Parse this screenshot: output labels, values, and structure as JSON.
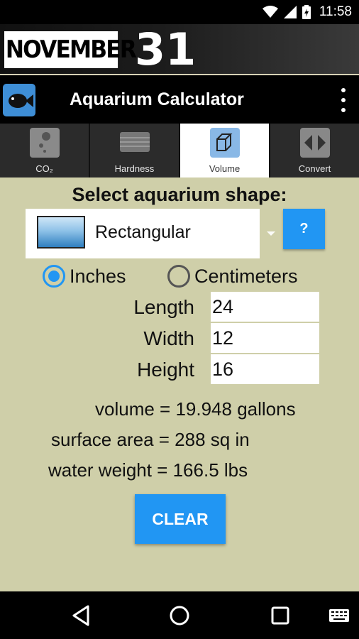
{
  "status_bar": {
    "time": "11:58"
  },
  "banner": {
    "month": "NOVEMBER",
    "day": "31"
  },
  "app_bar": {
    "title": "Aquarium Calculator"
  },
  "tabs": [
    {
      "label": "CO₂",
      "icon": "co2-icon"
    },
    {
      "label": "Hardness",
      "icon": "hardness-icon"
    },
    {
      "label": "Volume",
      "icon": "cube-icon",
      "active": true
    },
    {
      "label": "Convert",
      "icon": "convert-icon"
    }
  ],
  "main": {
    "heading": "Select aquarium shape:",
    "shape": {
      "selected": "Rectangular"
    },
    "help_label": "?",
    "units": {
      "inches": "Inches",
      "centimeters": "Centimeters",
      "selected": "Inches"
    },
    "fields": {
      "length": {
        "label": "Length",
        "value": "24"
      },
      "width": {
        "label": "Width",
        "value": "12"
      },
      "height": {
        "label": "Height",
        "value": "16"
      }
    },
    "results": {
      "volume": "volume = 19.948 gallons",
      "surface_area": "surface area = 288 sq in",
      "water_weight": "water weight = 166.5 lbs"
    },
    "clear_label": "CLEAR"
  },
  "colors": {
    "accent": "#2196f3",
    "background": "#cfcfa9"
  }
}
